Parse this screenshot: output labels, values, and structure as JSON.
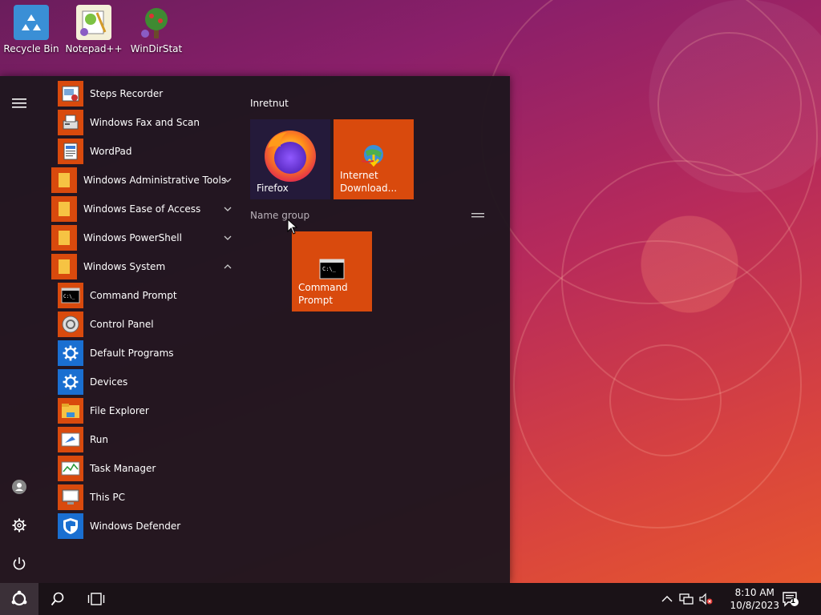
{
  "desktop": {
    "icons": [
      {
        "label": "Recycle Bin",
        "icon": "recycle-bin-icon"
      },
      {
        "label": "Notepad++",
        "icon": "notepad-plus-plus-icon"
      },
      {
        "label": "WinDirStat",
        "icon": "windirstat-icon"
      }
    ]
  },
  "start_menu": {
    "apps": [
      {
        "label": "Steps Recorder",
        "icon": "steps-recorder-icon"
      },
      {
        "label": "Windows Fax and Scan",
        "icon": "fax-scan-icon"
      },
      {
        "label": "WordPad",
        "icon": "wordpad-icon"
      },
      {
        "label": "Windows Administrative Tools",
        "icon": "folder-icon",
        "expand": "collapsed"
      },
      {
        "label": "Windows Ease of Access",
        "icon": "folder-icon",
        "expand": "collapsed"
      },
      {
        "label": "Windows PowerShell",
        "icon": "folder-icon",
        "expand": "collapsed"
      },
      {
        "label": "Windows System",
        "icon": "folder-icon",
        "expand": "expanded"
      },
      {
        "label": "Command Prompt",
        "icon": "command-prompt-icon"
      },
      {
        "label": "Control Panel",
        "icon": "control-panel-icon"
      },
      {
        "label": "Default Programs",
        "icon": "gear-icon"
      },
      {
        "label": "Devices",
        "icon": "gear-icon"
      },
      {
        "label": "File Explorer",
        "icon": "file-explorer-icon"
      },
      {
        "label": "Run",
        "icon": "run-icon"
      },
      {
        "label": "Task Manager",
        "icon": "task-manager-icon"
      },
      {
        "label": "This PC",
        "icon": "this-pc-icon"
      },
      {
        "label": "Windows Defender",
        "icon": "shield-icon"
      }
    ],
    "groups": [
      {
        "title": "Inretnut",
        "tiles": [
          {
            "label_lines": [
              "Firefox"
            ],
            "icon": "firefox-icon"
          },
          {
            "label_lines": [
              "Internet",
              "Download..."
            ],
            "icon": "internet-download-manager-icon"
          }
        ]
      },
      {
        "title": "Name group",
        "tiles": [
          {
            "label_lines": [
              "Command",
              "Prompt"
            ],
            "icon": "command-prompt-icon"
          }
        ]
      }
    ]
  },
  "taskbar": {
    "time": "8:10 AM",
    "date": "10/8/2023",
    "notification_count": "1"
  },
  "colors": {
    "tile": "#d94a0d",
    "accent": "#d94a0d",
    "menu_bg": "#1e161e",
    "taskbar_bg": "#1a1217"
  }
}
